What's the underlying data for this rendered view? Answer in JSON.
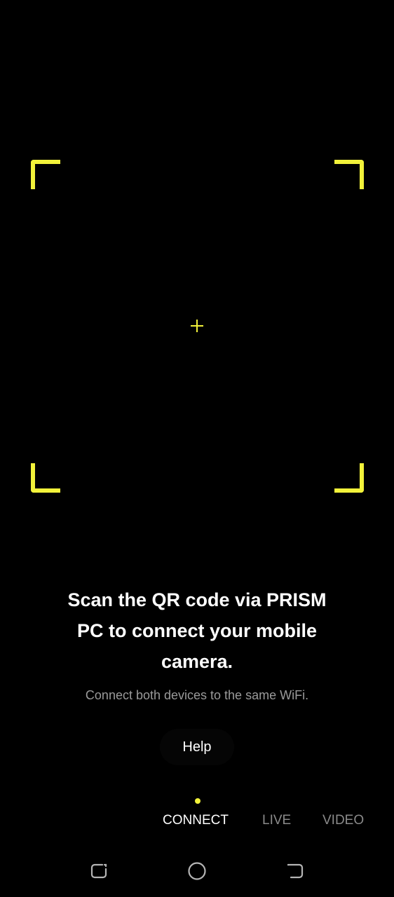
{
  "scanner": {
    "frame_color": "#f2f23a",
    "crosshair_icon": "plus-icon"
  },
  "instructions": {
    "headline_line1": "Scan the QR code via PRISM",
    "headline_line2": "PC to connect your mobile",
    "headline_line3": "camera.",
    "subtext": "Connect both devices to the same WiFi."
  },
  "help": {
    "label": "Help"
  },
  "modes": {
    "active": "CONNECT",
    "tabs": [
      {
        "label": "CONNECT"
      },
      {
        "label": "LIVE"
      },
      {
        "label": "VIDEO"
      }
    ]
  },
  "navbar": {
    "recent_icon": "recent-apps-icon",
    "home_icon": "home-icon",
    "back_icon": "back-icon"
  }
}
